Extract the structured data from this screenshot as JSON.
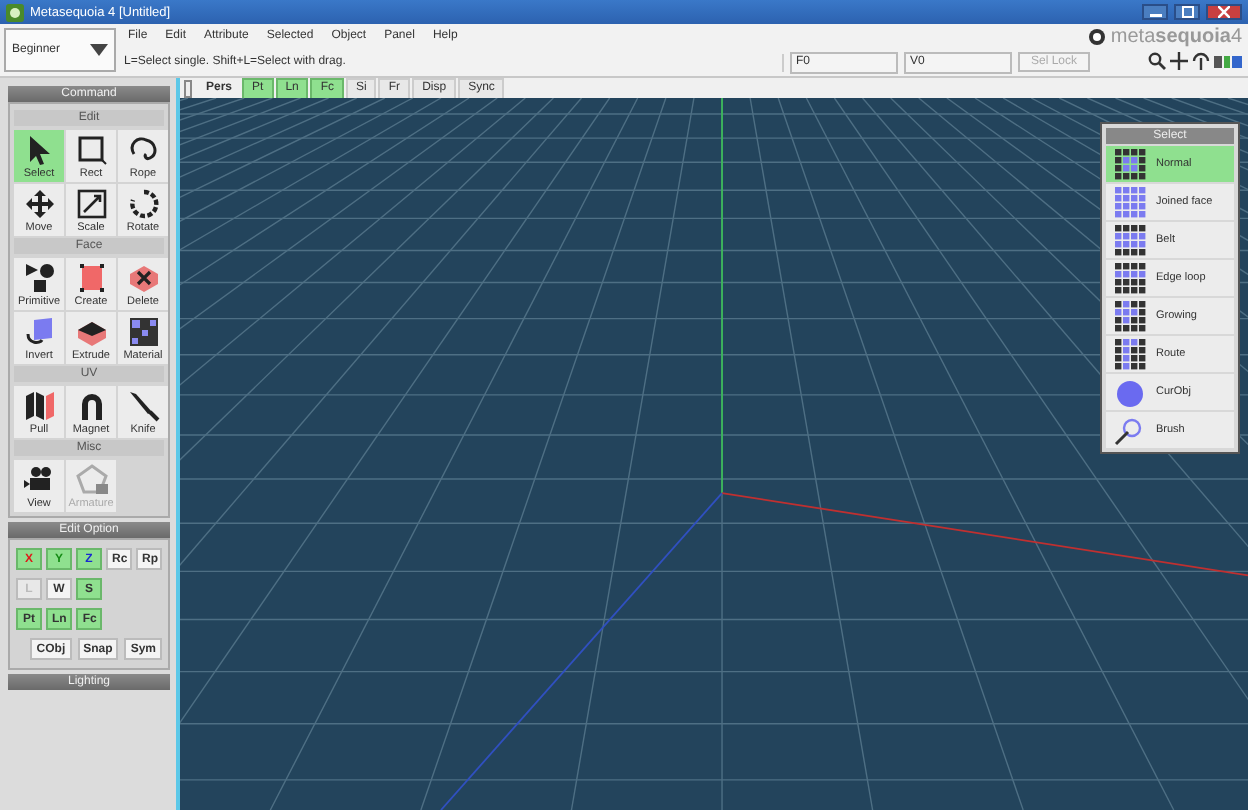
{
  "window": {
    "title": "Metasequoia 4 [Untitled]"
  },
  "mode_dropdown": {
    "value": "Beginner"
  },
  "menu": [
    "File",
    "Edit",
    "Attribute",
    "Selected",
    "Object",
    "Panel",
    "Help"
  ],
  "hint": "L=Select single. Shift+L=Select with drag.",
  "status_fields": [
    "F0",
    "V0"
  ],
  "sel_lock": {
    "label": "Sel Lock",
    "disabled": true
  },
  "logo": {
    "text": "meta**sequoia**4"
  },
  "view_tabs": [
    {
      "label": "Pers",
      "kind": "label"
    },
    {
      "label": "Pt",
      "kind": "toggle",
      "on": true
    },
    {
      "label": "Ln",
      "kind": "toggle",
      "on": true
    },
    {
      "label": "Fc",
      "kind": "toggle",
      "on": true
    },
    {
      "label": "Si",
      "kind": "toggle",
      "on": false
    },
    {
      "label": "Fr",
      "kind": "toggle",
      "on": false
    },
    {
      "label": "Disp",
      "kind": "toggle",
      "on": false
    },
    {
      "label": "Sync",
      "kind": "toggle",
      "on": false
    }
  ],
  "command_panel": {
    "title": "Command",
    "sections": [
      {
        "title": "Edit",
        "tools": [
          {
            "label": "Select",
            "selected": true,
            "disabled": false
          },
          {
            "label": "Rect",
            "selected": false,
            "disabled": false
          },
          {
            "label": "Rope",
            "selected": false,
            "disabled": false
          },
          {
            "label": "Move",
            "selected": false,
            "disabled": false
          },
          {
            "label": "Scale",
            "selected": false,
            "disabled": false
          },
          {
            "label": "Rotate",
            "selected": false,
            "disabled": false
          }
        ]
      },
      {
        "title": "Face",
        "tools": [
          {
            "label": "Primitive",
            "selected": false,
            "disabled": false
          },
          {
            "label": "Create",
            "selected": false,
            "disabled": false
          },
          {
            "label": "Delete",
            "selected": false,
            "disabled": false
          },
          {
            "label": "Invert",
            "selected": false,
            "disabled": false
          },
          {
            "label": "Extrude",
            "selected": false,
            "disabled": false
          },
          {
            "label": "Material",
            "selected": false,
            "disabled": false
          }
        ]
      },
      {
        "title": "UV",
        "tools": [
          {
            "label": "Pull",
            "selected": false,
            "disabled": false
          },
          {
            "label": "Magnet",
            "selected": false,
            "disabled": false
          },
          {
            "label": "Knife",
            "selected": false,
            "disabled": false
          }
        ]
      },
      {
        "title": "Misc",
        "tools": [
          {
            "label": "View",
            "selected": false,
            "disabled": false
          },
          {
            "label": "Armature",
            "selected": false,
            "disabled": true
          }
        ]
      }
    ]
  },
  "edit_option": {
    "title": "Edit Option",
    "rows": [
      [
        {
          "label": "X",
          "on": true,
          "disabled": false
        },
        {
          "label": "Y",
          "on": true,
          "disabled": false
        },
        {
          "label": "Z",
          "on": true,
          "disabled": false
        },
        {
          "label": "Rc",
          "on": false,
          "disabled": false
        },
        {
          "label": "Rp",
          "on": false,
          "disabled": false
        }
      ],
      [
        {
          "label": "L",
          "on": false,
          "disabled": true
        },
        {
          "label": "W",
          "on": false,
          "disabled": false
        },
        {
          "label": "S",
          "on": true,
          "disabled": false
        }
      ],
      [
        {
          "label": "Pt",
          "on": true,
          "disabled": false
        },
        {
          "label": "Ln",
          "on": true,
          "disabled": false
        },
        {
          "label": "Fc",
          "on": true,
          "disabled": false
        }
      ]
    ],
    "actions": [
      {
        "label": "CObj",
        "on": false
      },
      {
        "label": "Snap",
        "on": false
      },
      {
        "label": "Sym",
        "on": false
      }
    ]
  },
  "lighting": {
    "title": "Lighting"
  },
  "select_panel": {
    "title": "Select",
    "items": [
      {
        "label": "Normal",
        "selected": true
      },
      {
        "label": "Joined face",
        "selected": false
      },
      {
        "label": "Belt",
        "selected": false
      },
      {
        "label": "Edge loop",
        "selected": false
      },
      {
        "label": "Growing",
        "selected": false
      },
      {
        "label": "Route",
        "selected": false
      },
      {
        "label": "CurObj",
        "selected": false
      },
      {
        "label": "Brush",
        "selected": false
      }
    ]
  }
}
